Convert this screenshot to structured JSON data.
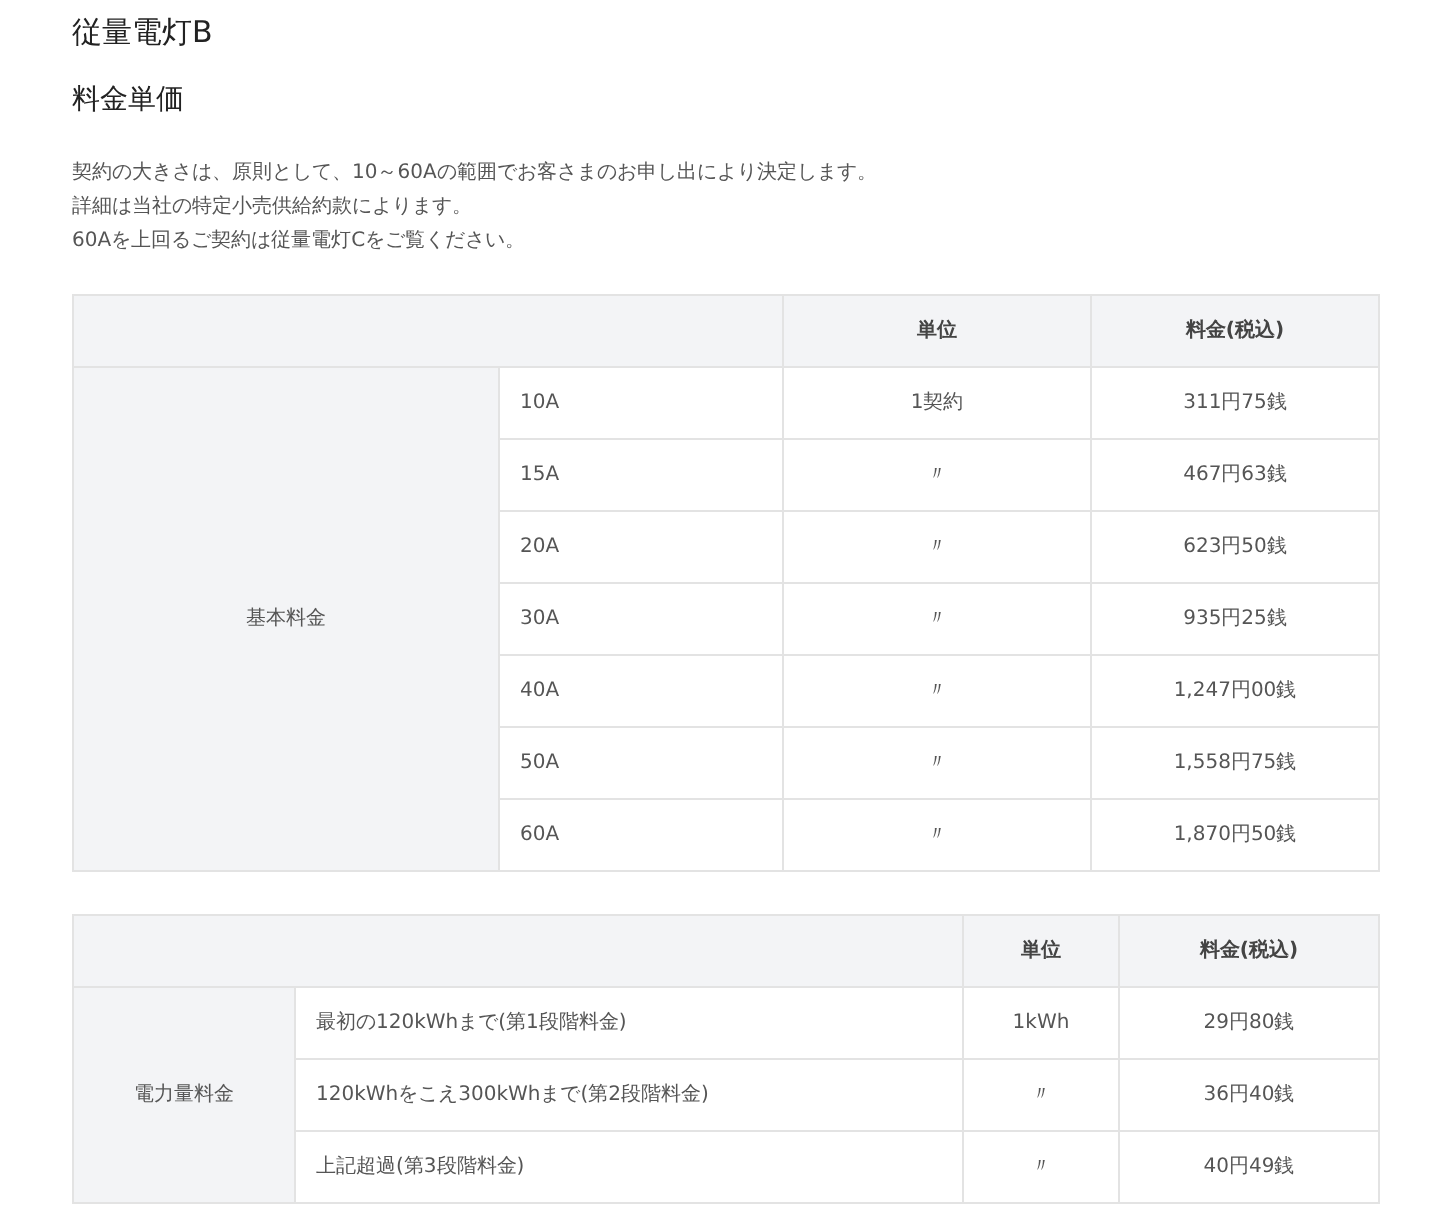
{
  "title": "従量電灯B",
  "heading": "料金単価",
  "notes": [
    "契約の大きさは、原則として、10～60Aの範囲でお客さまのお申し出により決定します。",
    "詳細は当社の特定小売供給約款によります。",
    "60Aを上回るご契約は従量電灯Cをご覧ください。"
  ],
  "basic_table": {
    "columns": [
      "単位",
      "料金(税込)"
    ],
    "group": "基本料金",
    "rows": [
      {
        "ampere": "10A",
        "unit": "1契約",
        "price": "311円75銭"
      },
      {
        "ampere": "15A",
        "unit": "〃",
        "price": "467円63銭"
      },
      {
        "ampere": "20A",
        "unit": "〃",
        "price": "623円50銭"
      },
      {
        "ampere": "30A",
        "unit": "〃",
        "price": "935円25銭"
      },
      {
        "ampere": "40A",
        "unit": "〃",
        "price": "1,247円00銭"
      },
      {
        "ampere": "50A",
        "unit": "〃",
        "price": "1,558円75銭"
      },
      {
        "ampere": "60A",
        "unit": "〃",
        "price": "1,870円50銭"
      }
    ]
  },
  "energy_table": {
    "columns": [
      "単位",
      "料金(税込)"
    ],
    "group": "電力量料金",
    "rows": [
      {
        "tier": "最初の120kWhまで(第1段階料金)",
        "unit": "1kWh",
        "price": "29円80銭"
      },
      {
        "tier": "120kWhをこえ300kWhまで(第2段階料金)",
        "unit": "〃",
        "price": "36円40銭"
      },
      {
        "tier": "上記超過(第3段階料金)",
        "unit": "〃",
        "price": "40円49銭"
      }
    ]
  }
}
